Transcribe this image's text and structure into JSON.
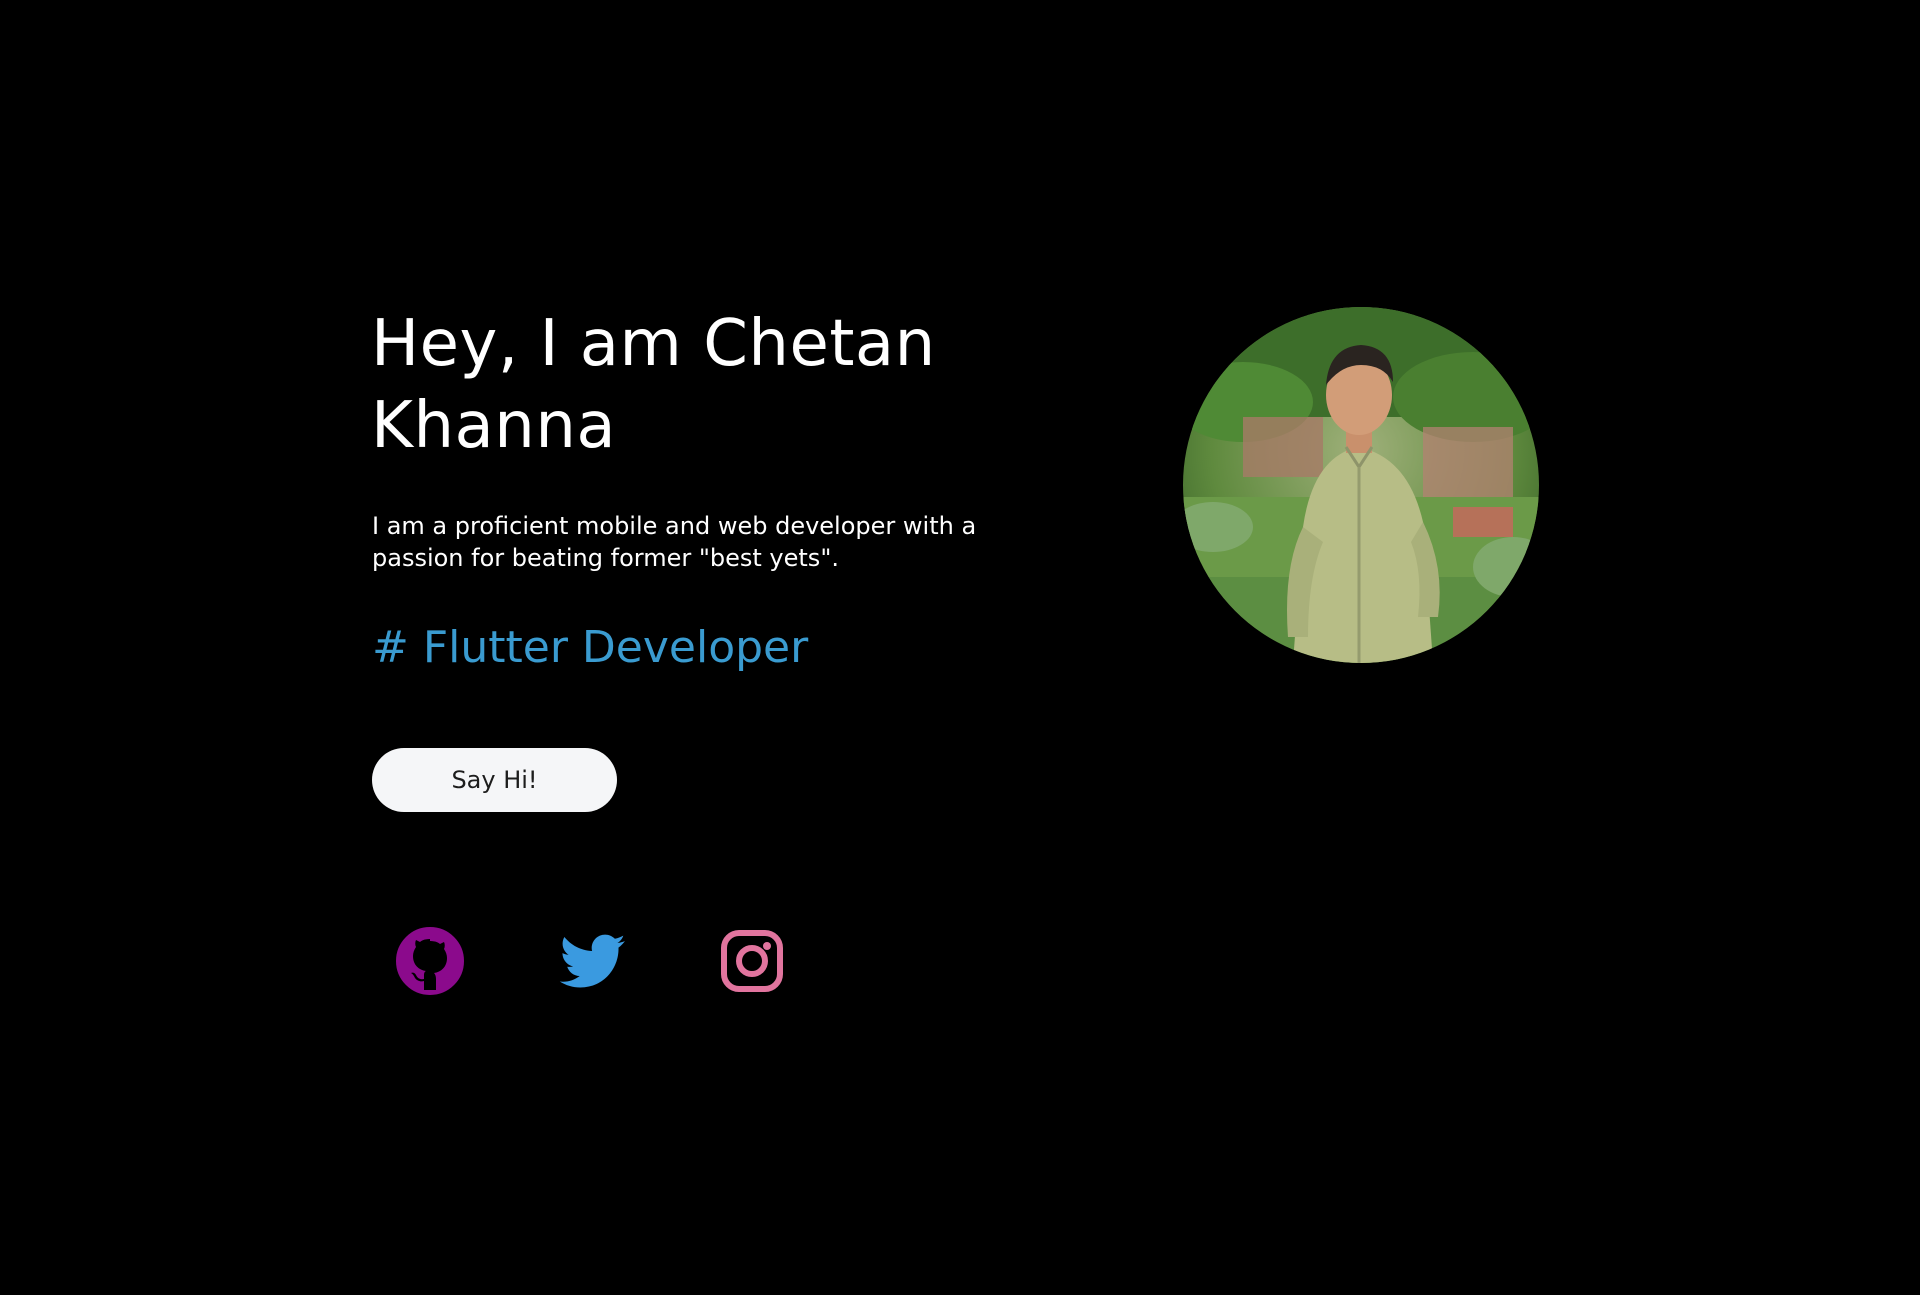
{
  "hero": {
    "title": "Hey, I am Chetan Khanna",
    "intro": "I am a proficient mobile and web developer with a passion for beating former \"best yets\".",
    "role": "# Flutter Developer",
    "cta_label": "Say Hi!"
  },
  "social": [
    {
      "icon": "github-icon",
      "color": "#8b0a8c"
    },
    {
      "icon": "twitter-icon",
      "color": "#3a9ae0"
    },
    {
      "icon": "instagram-icon",
      "color": "#e1749e"
    }
  ],
  "avatar": {
    "icon": "profile-photo"
  },
  "colors": {
    "background": "#000000",
    "text": "#ffffff",
    "accent": "#3a9bd0",
    "button_bg": "#f5f6f8",
    "button_text": "#1d1d1d"
  }
}
